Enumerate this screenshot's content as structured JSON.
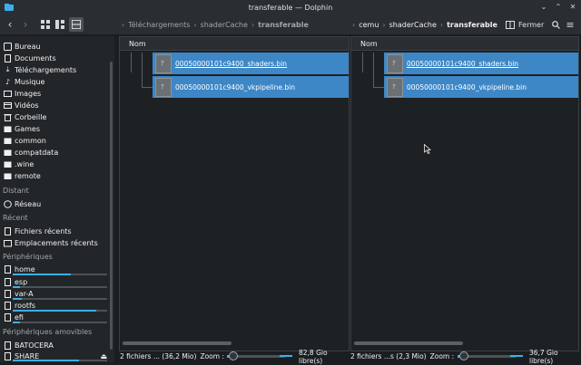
{
  "window": {
    "title": "transferable — Dolphin"
  },
  "breadcrumb_left": {
    "items": [
      "Téléchargements",
      "shaderCache",
      "transferable"
    ]
  },
  "breadcrumb_right": {
    "items": [
      "cemu",
      "shaderCache",
      "transferable"
    ]
  },
  "toolbar": {
    "close_split_label": "Fermer"
  },
  "sidebar": {
    "places": [
      "Bureau",
      "Documents",
      "Téléchargements",
      "Musique",
      "Images",
      "Vidéos",
      "Corbeille",
      "Games",
      "common",
      "compatdata",
      ".wine",
      "remote"
    ],
    "remote_heading": "Distant",
    "remote_items": [
      "Réseau"
    ],
    "recent_heading": "Récent",
    "recent_items": [
      "Fichiers récents",
      "Emplacements récents"
    ],
    "devices_heading": "Périphériques",
    "devices": [
      {
        "label": "home",
        "usage": 0.62
      },
      {
        "label": "esp",
        "usage": 0.08
      },
      {
        "label": "var-A",
        "usage": 0.1
      },
      {
        "label": "rootfs",
        "usage": 0.88
      },
      {
        "label": "efi",
        "usage": 0.08
      }
    ],
    "removable_heading": "Périphériques amovibles",
    "removable": [
      {
        "label": "BATOCERA"
      },
      {
        "label": "SHARE",
        "usage": 0.7
      }
    ]
  },
  "left_pane": {
    "column_header": "Nom",
    "files": [
      "00050000101c9400_shaders.bin",
      "00050000101c9400_vkpipeline.bin"
    ],
    "status_text": "2 fichiers ... (36,2 Mio)",
    "zoom_label": "Zoom :",
    "free_space": "82,8 Gio libre(s)",
    "zoom_level": 0.1
  },
  "right_pane": {
    "column_header": "Nom",
    "files": [
      "00050000101c9400_shaders.bin",
      "00050000101c9400_vkpipeline.bin"
    ],
    "status_text": "2 fichiers ...s (2,3 Mio)",
    "zoom_label": "Zoom :",
    "free_space": "36,7 Gio libre(s)",
    "zoom_level": 0.1
  },
  "colors": {
    "accent": "#3daee9",
    "selection": "#3d87c6",
    "window_bg": "#1b1e20"
  }
}
